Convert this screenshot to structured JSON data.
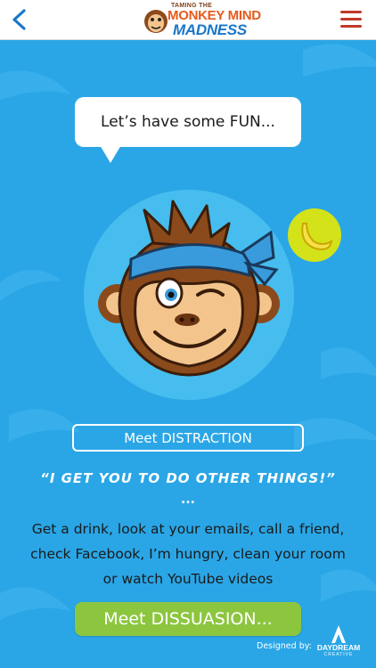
{
  "header": {
    "logo_small": "TAMING THE",
    "logo_line1": "MONKEY MIND",
    "logo_line2": "MADNESS",
    "back_icon": "chevron-left-icon",
    "menu_icon": "hamburger-menu-icon"
  },
  "bubble": {
    "text": "Let’s have some FUN..."
  },
  "character": {
    "meet_label": "Meet DISTRACTION",
    "quote": "“I GET YOU TO DO OTHER THINGS!”",
    "ellipsis": "...",
    "description": "Get a drink, look at your emails, call a friend, check Facebook, I’m hungry, clean your room or watch YouTube videos"
  },
  "cta": {
    "label": "Meet DISSUASION..."
  },
  "footer": {
    "designed_by": "Designed by:",
    "brand": "DAYDREAM",
    "brand_sub": "CREATIVE"
  },
  "colors": {
    "background": "#2aa6e6",
    "accent_green": "#8cc63f",
    "menu_red": "#c0392b",
    "back_blue": "#1a76c9",
    "banana_circle": "#d4e21a"
  }
}
